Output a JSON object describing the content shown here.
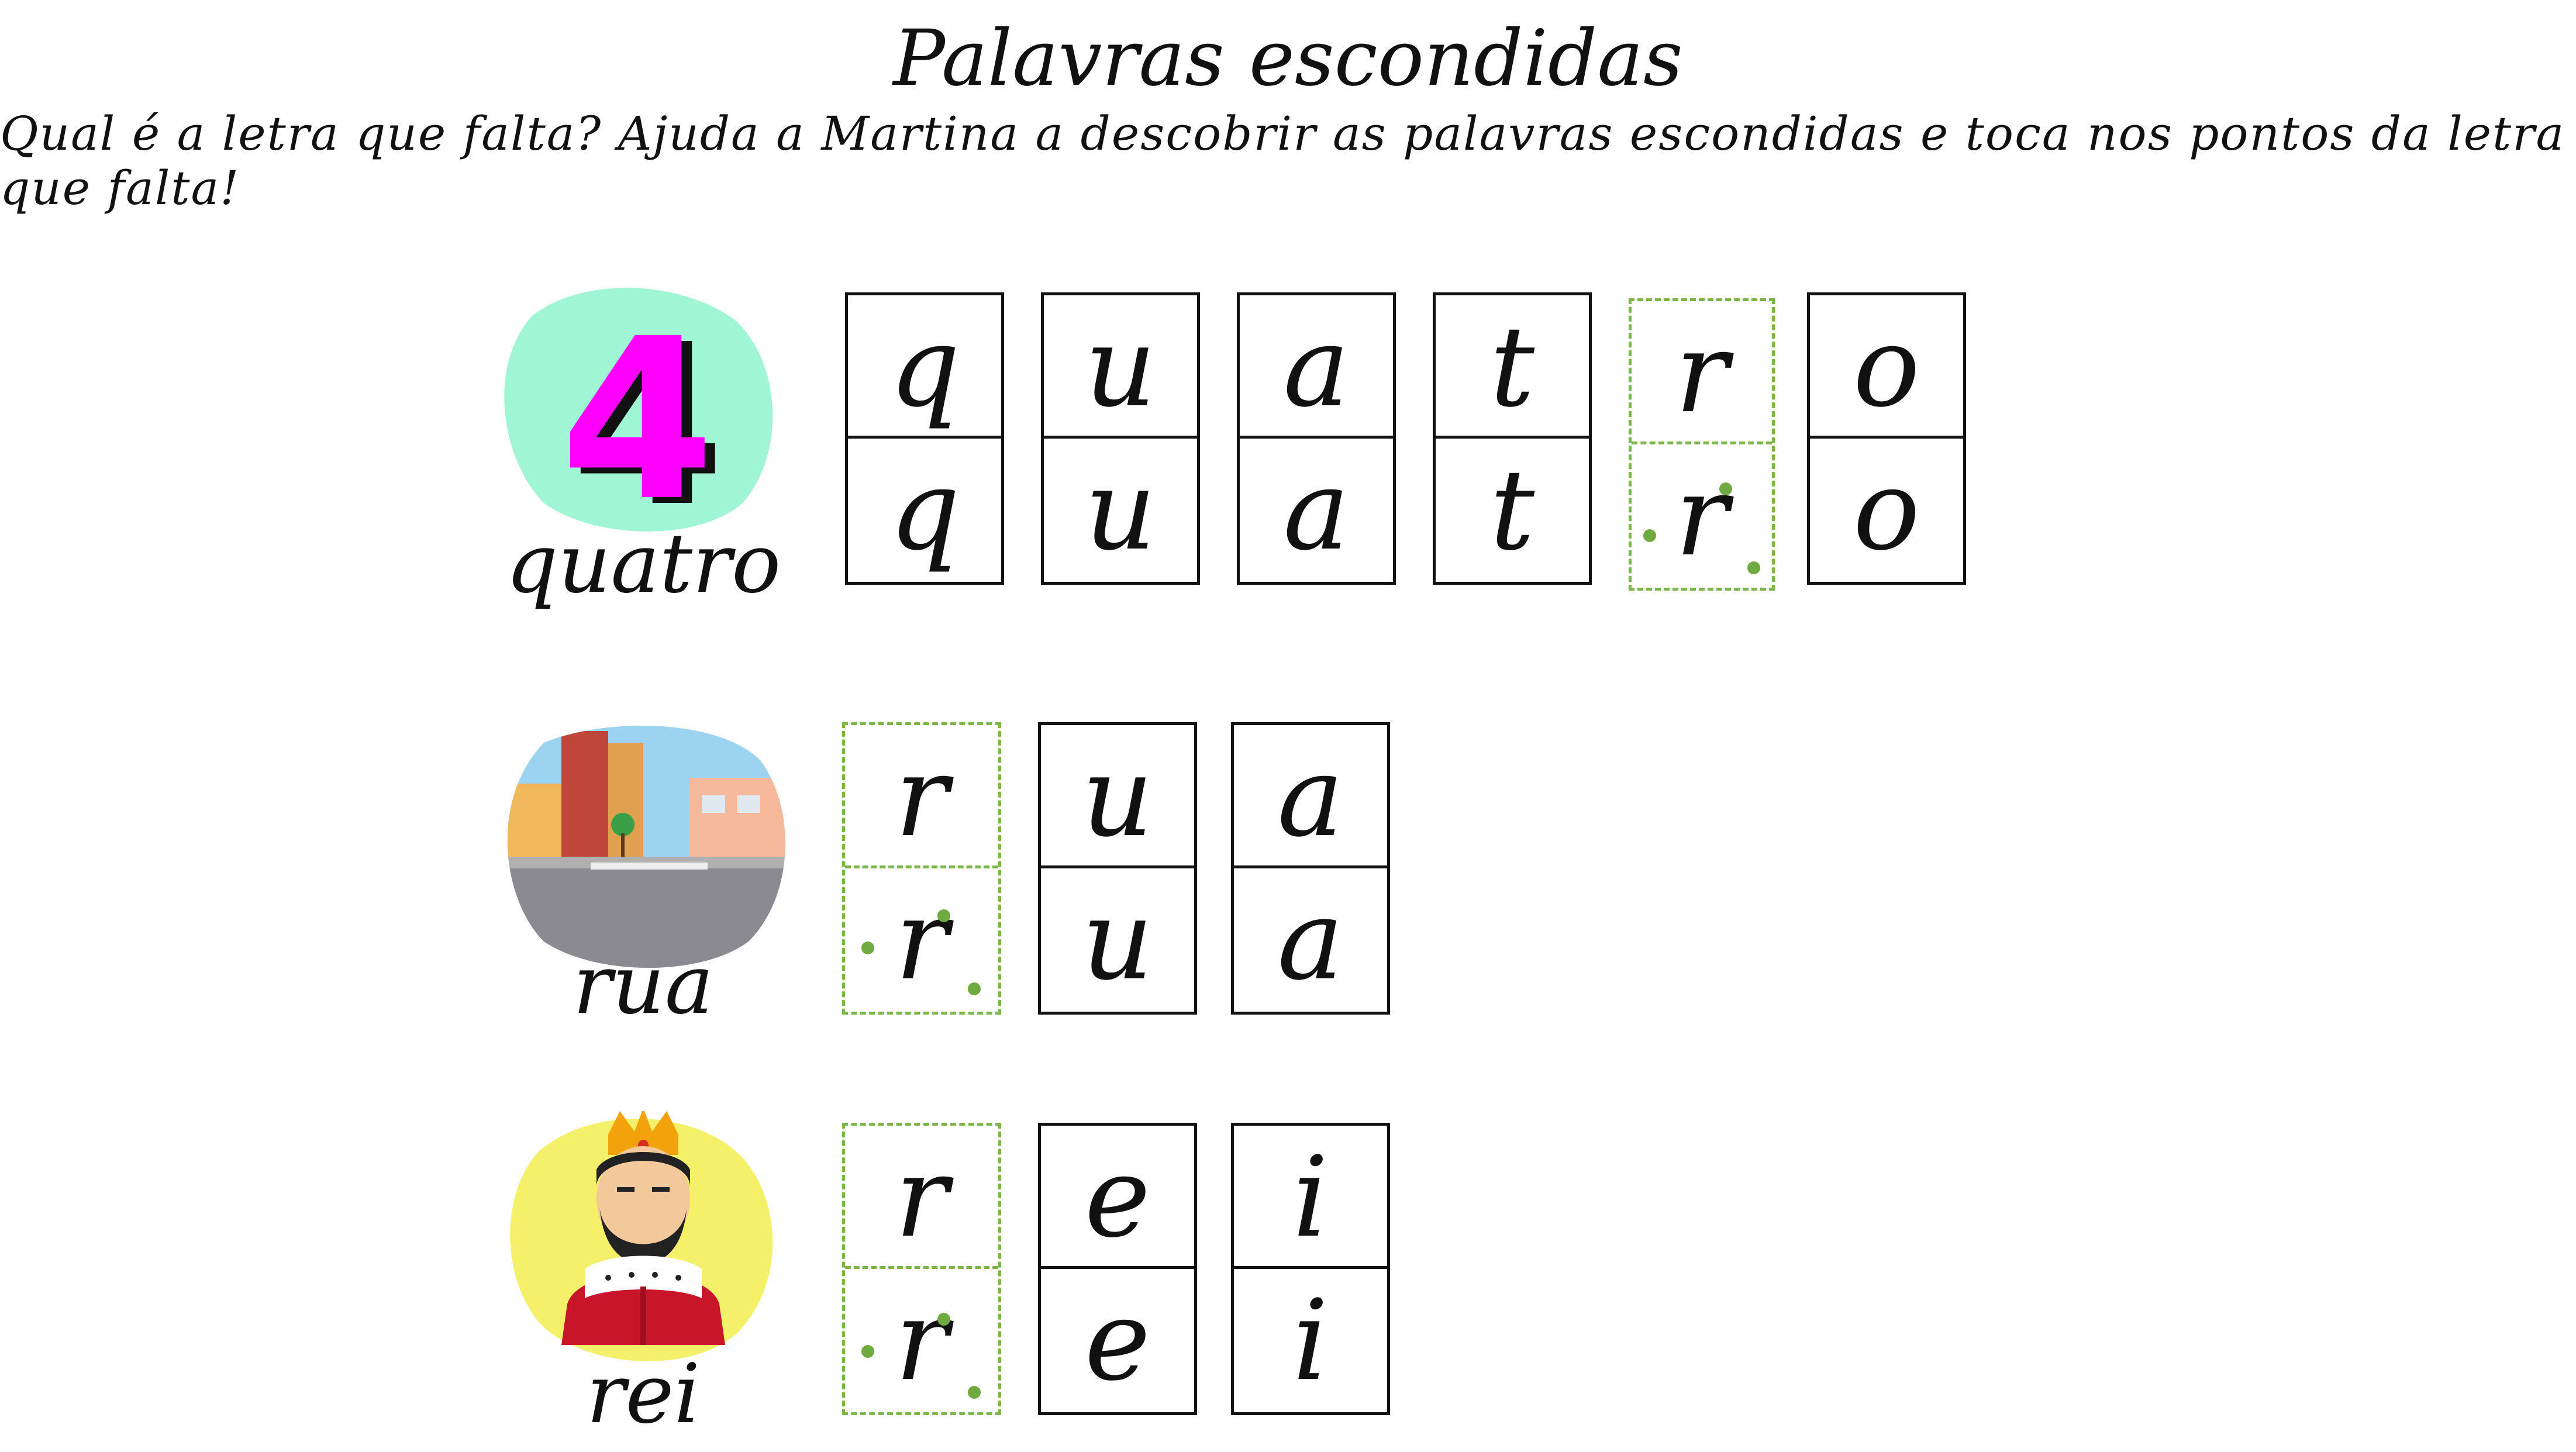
{
  "title": "Palavras escondidas",
  "instructions": "Qual é a letra que falta? Ajuda a Martina a descobrir as palavras escondidas e toca nos pontos da letra que falta!",
  "colors": {
    "missing_border": "#7ab648",
    "trace_dot": "#6eaa3f",
    "number_four": "#ff00ff",
    "blob_green": "#a0f5d4",
    "blob_yellow": "#f5f06a"
  },
  "words": [
    {
      "label": "quatro",
      "illustration": "number-four-icon",
      "numeral": "4",
      "letters": [
        "q",
        "u",
        "a",
        "t",
        "r",
        "o"
      ],
      "missing_index": 4
    },
    {
      "label": "rua",
      "illustration": "street-icon",
      "letters": [
        "r",
        "u",
        "a"
      ],
      "missing_index": 0
    },
    {
      "label": "rei",
      "illustration": "king-icon",
      "letters": [
        "r",
        "e",
        "i"
      ],
      "missing_index": 0
    }
  ]
}
